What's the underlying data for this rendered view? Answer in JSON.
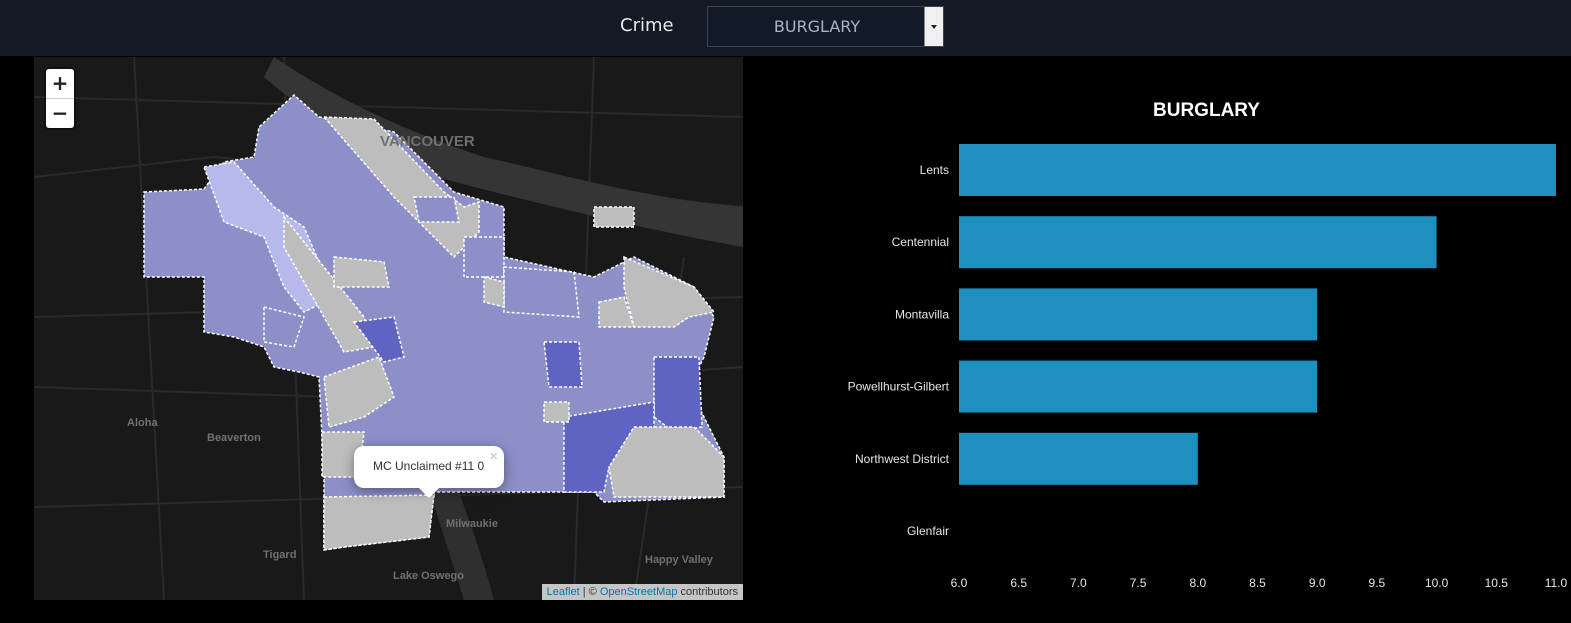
{
  "header": {
    "crime_label": "Crime",
    "select_value": "BURGLARY"
  },
  "map": {
    "zoom_in": "+",
    "zoom_out": "−",
    "popup": {
      "text": "MC Unclaimed #11 0",
      "close": "×"
    },
    "attribution": {
      "leaflet": "Leaflet",
      "sep": " | © ",
      "osm": "OpenStreetMap",
      "suffix": " contributors"
    },
    "place_labels": [
      "VANCOUVER",
      "Aloha",
      "Beaverton",
      "Tigard",
      "Lake Oswego",
      "Milwaukie",
      "Happy Valley"
    ],
    "colors": {
      "district_fill": "#8d8fc9",
      "dark_fill": "#5f63c2",
      "light_fill": "#b7b9ec",
      "unclaimed_fill": "#bdbdbd",
      "border": "#ffffff"
    }
  },
  "chart_data": {
    "type": "bar",
    "orientation": "horizontal",
    "title": "BURGLARY",
    "categories": [
      "Lents",
      "Centennial",
      "Montavilla",
      "Powellhurst-Gilbert",
      "Northwest District",
      "Glenfair"
    ],
    "values": [
      11,
      10,
      9,
      9,
      8,
      6
    ],
    "xlim": [
      6,
      11
    ],
    "xticks": [
      "6.0",
      "6.5",
      "7.0",
      "7.5",
      "8.0",
      "8.5",
      "9.0",
      "9.5",
      "10.0",
      "10.5",
      "11.0"
    ],
    "bar_color": "#1e90c0",
    "grid": false
  }
}
